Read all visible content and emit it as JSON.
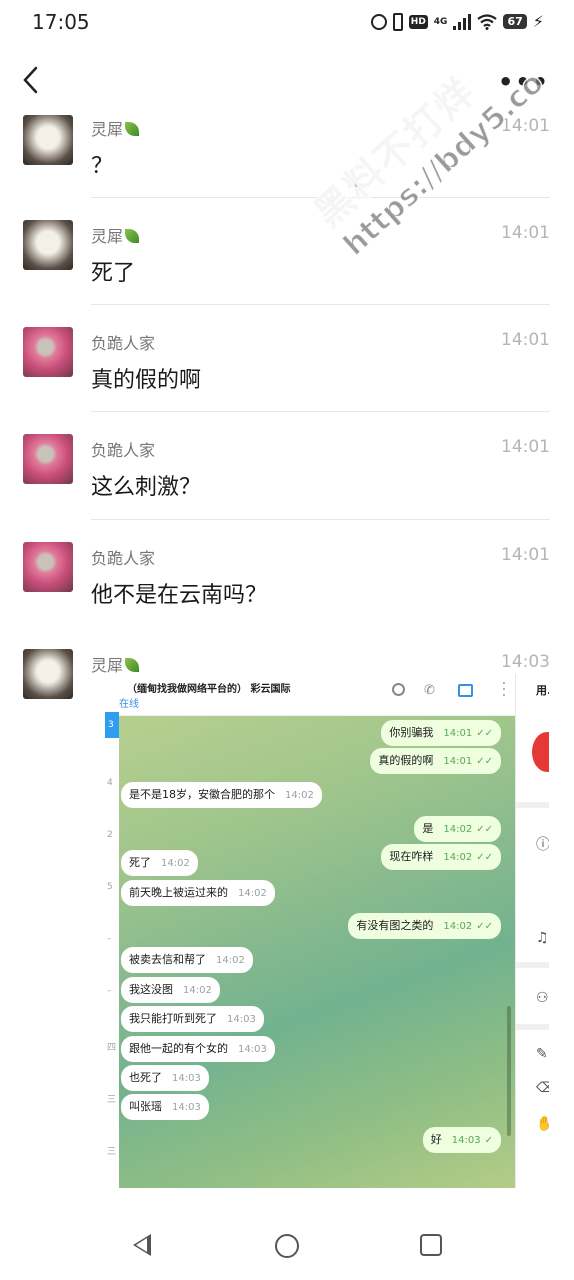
{
  "status_bar": {
    "time": "17:05",
    "network": "4G",
    "hd": "HD",
    "battery": "67"
  },
  "header": {
    "more": "•••"
  },
  "messages": [
    {
      "sender": "灵犀",
      "leaf": true,
      "time": "14:01",
      "text": "？",
      "avatar": "cat"
    },
    {
      "sender": "灵犀",
      "leaf": true,
      "time": "14:01",
      "text": "死了",
      "avatar": "cat"
    },
    {
      "sender": "负跪人家",
      "leaf": false,
      "time": "14:01",
      "text": "真的假的啊",
      "avatar": "rose"
    },
    {
      "sender": "负跪人家",
      "leaf": false,
      "time": "14:01",
      "text": "这么刺激？",
      "avatar": "rose"
    },
    {
      "sender": "负跪人家",
      "leaf": false,
      "time": "14:01",
      "text": "他不是在云南吗？",
      "avatar": "rose"
    },
    {
      "sender": "灵犀",
      "leaf": true,
      "time": "14:03",
      "avatar": "cat"
    }
  ],
  "screenshot": {
    "title": "（缅甸找我做网络平台的） 彩云国际",
    "status": "在线",
    "right_label": "用.",
    "left_numbers": [
      "3",
      "4",
      "2",
      "5",
      "–",
      "–",
      "四",
      "三",
      "三"
    ],
    "bubbles": [
      {
        "side": "out",
        "text": "你别骗我",
        "time": "14:01"
      },
      {
        "side": "out",
        "text": "真的假的啊",
        "time": "14:01"
      },
      {
        "side": "in",
        "text": "是不是18岁，安徽合肥的那个",
        "time": "14:02"
      },
      {
        "side": "out",
        "text": "是",
        "time": "14:02"
      },
      {
        "side": "out",
        "text": "现在咋样",
        "time": "14:02"
      },
      {
        "side": "in",
        "text": "死了",
        "time": "14:02"
      },
      {
        "side": "in",
        "text": "前天晚上被运过来的",
        "time": "14:02"
      },
      {
        "side": "out",
        "text": "有没有图之类的",
        "time": "14:02"
      },
      {
        "side": "in",
        "text": "被卖去信和帮了",
        "time": "14:02"
      },
      {
        "side": "in",
        "text": "我这没图",
        "time": "14:02"
      },
      {
        "side": "in",
        "text": "我只能打听到死了",
        "time": "14:03"
      },
      {
        "side": "in",
        "text": "跟他一起的有个女的",
        "time": "14:03"
      },
      {
        "side": "in",
        "text": "也死了",
        "time": "14:03"
      },
      {
        "side": "in",
        "text": "叫张瑶",
        "time": "14:03"
      },
      {
        "side": "out",
        "text": "好",
        "time": "14:03"
      }
    ]
  },
  "watermark": {
    "line1": "黑料不打烊",
    "line2": "https://bdy5.co"
  },
  "colors": {
    "time_gray": "#b5b5b5",
    "sender_gray": "#777777",
    "bubble_out": "#eefedf",
    "tg_blue": "#3a8ee6"
  }
}
